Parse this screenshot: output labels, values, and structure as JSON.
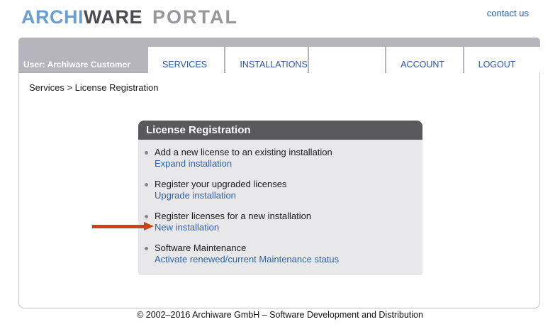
{
  "header": {
    "logo": {
      "part1": "ARCHI",
      "part2": "WARE",
      "part3": "PORTAL"
    },
    "contact_link": "contact us"
  },
  "nav": {
    "user_label": "User: Archiware Customer",
    "tabs": [
      {
        "label": "SERVICES"
      },
      {
        "label": "INSTALLATIONS"
      },
      {
        "label": ""
      },
      {
        "label": "ACCOUNT"
      },
      {
        "label": "LOGOUT"
      }
    ]
  },
  "breadcrumb": "Services > License Registration",
  "panel": {
    "title": "License Registration",
    "items": [
      {
        "title": "Add a new license to an existing installation",
        "link": "Expand installation"
      },
      {
        "title": "Register your upgraded licenses",
        "link": "Upgrade installation"
      },
      {
        "title": "Register licenses for a new installation",
        "link": "New installation"
      },
      {
        "title": "Software Maintenance",
        "link": "Activate renewed/current Maintenance status"
      }
    ]
  },
  "annotation": {
    "arrow_target": "New installation",
    "arrow_color": "#c8450d"
  },
  "footer": {
    "copyright": "© 2002–2016 Archiware GmbH – Software Development and Distribution"
  },
  "colors": {
    "logo_blue": "#6b9fd3",
    "logo_dark_gray": "#4c4c4e",
    "logo_light_gray": "#97979a",
    "nav_gray": "#b5b5bb",
    "nav_link_blue": "#2b55a3",
    "panel_header_gray": "#59595b",
    "panel_body_gray": "#e8e8ea",
    "link_blue": "#2e64a8",
    "arrow_orange": "#c8450d"
  }
}
